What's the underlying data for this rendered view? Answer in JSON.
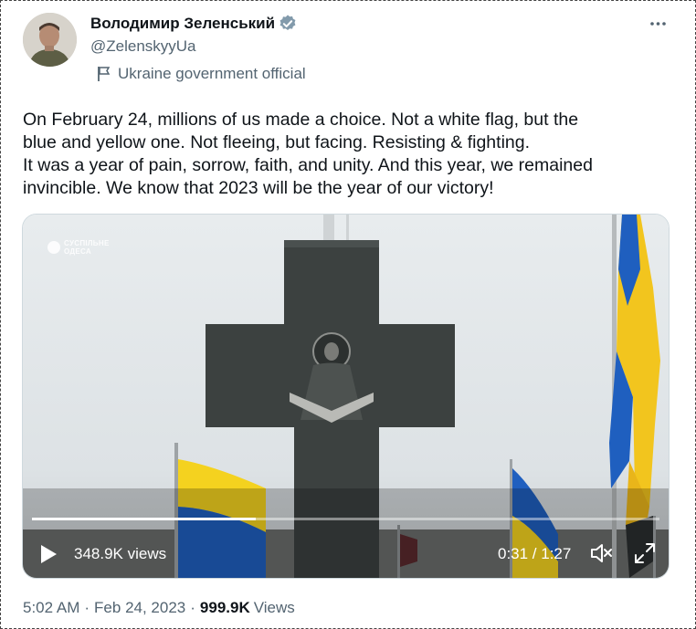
{
  "author": {
    "name": "Володимир Зеленський",
    "handle": "@ZelenskyyUa",
    "label": "Ukraine government official"
  },
  "tweet": {
    "text": "On February 24, millions of us made a choice. Not a white flag, but the\nblue and yellow one. Not fleeing, but facing. Resisting & fighting.\nIt was a year of pain, sorrow, faith, and unity. And this year, we remained\ninvincible. We know that 2023 will be the year of our victory!"
  },
  "video": {
    "watermark_line1": "СУСПІЛЬНЕ",
    "watermark_line2": "ОДЕСА",
    "views": "348.9K views",
    "time": "0:31 / 1:27",
    "progress": 0.356
  },
  "footer": {
    "time": "5:02 AM",
    "date": "Feb 24, 2023",
    "views_count": "999.9K",
    "views_label": "Views",
    "separator": "·"
  },
  "colors": {
    "verified": "#829aab",
    "ukraine_blue": "#1f5fbf",
    "ukraine_yellow": "#f4d21f"
  }
}
